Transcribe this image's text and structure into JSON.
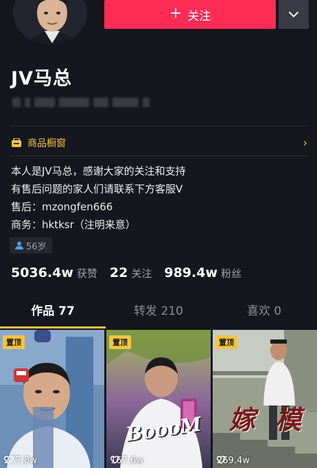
{
  "profile": {
    "username": "JV马总",
    "follow_label": "关注",
    "follow_plus": "+",
    "age": "56岁"
  },
  "shop": {
    "label": "商品橱窗"
  },
  "bio": {
    "lines": [
      "本人是JV马总，感谢大家的关注和支持",
      "有售后问题的家人们请联系下方客服V",
      "售后：mzongfen666",
      "商务：hktksr（注明来意）"
    ]
  },
  "stats": {
    "likes_value": "5036.4w",
    "likes_label": "获赞",
    "following_value": "22",
    "following_label": "关注",
    "followers_value": "989.4w",
    "followers_label": "粉丝"
  },
  "tabs": [
    {
      "label": "作品 77",
      "active": true
    },
    {
      "label": "转发 210",
      "active": false
    },
    {
      "label": "喜欢 0",
      "active": false
    }
  ],
  "videos": [
    {
      "pin_label": "置顶",
      "likes": "277.8w"
    },
    {
      "pin_label": "置顶",
      "likes": "167.6w",
      "overlay": "BoooM"
    },
    {
      "pin_label": "置顶",
      "likes": "269.4w",
      "overlay": "嫁 模"
    }
  ],
  "colors": {
    "background": "#15161e",
    "accent_red": "#fe2c55",
    "accent_yellow": "#f5c442",
    "muted_text": "#9da0aa"
  }
}
